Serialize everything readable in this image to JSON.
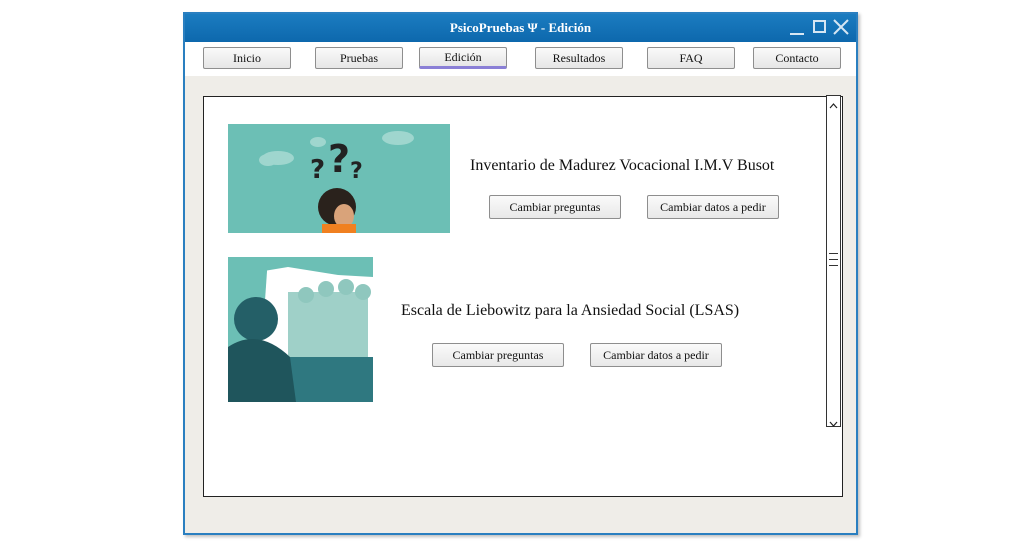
{
  "window": {
    "title": "PsicoPruebas Ψ - Edición"
  },
  "nav": [
    {
      "label": "Inicio"
    },
    {
      "label": "Pruebas"
    },
    {
      "label": "Edición"
    },
    {
      "label": "Resultados"
    },
    {
      "label": "FAQ"
    },
    {
      "label": "Contacto"
    }
  ],
  "tests": [
    {
      "title": "Inventario de Madurez Vocacional I.M.V Busot",
      "btn_questions": "Cambiar preguntas",
      "btn_data": "Cambiar datos a pedir",
      "image_icon": "question-head-illustration"
    },
    {
      "title": "Escala de Liebowitz para la Ansiedad Social (LSAS)",
      "btn_questions": "Cambiar preguntas",
      "btn_data": "Cambiar datos a pedir",
      "image_icon": "crowd-silhouette-illustration"
    }
  ],
  "colors": {
    "titlebar": "#0d68ad",
    "window_border": "#2a7fc0",
    "teal": "#6cbfb5",
    "active_underline": "#8a7fd6"
  }
}
